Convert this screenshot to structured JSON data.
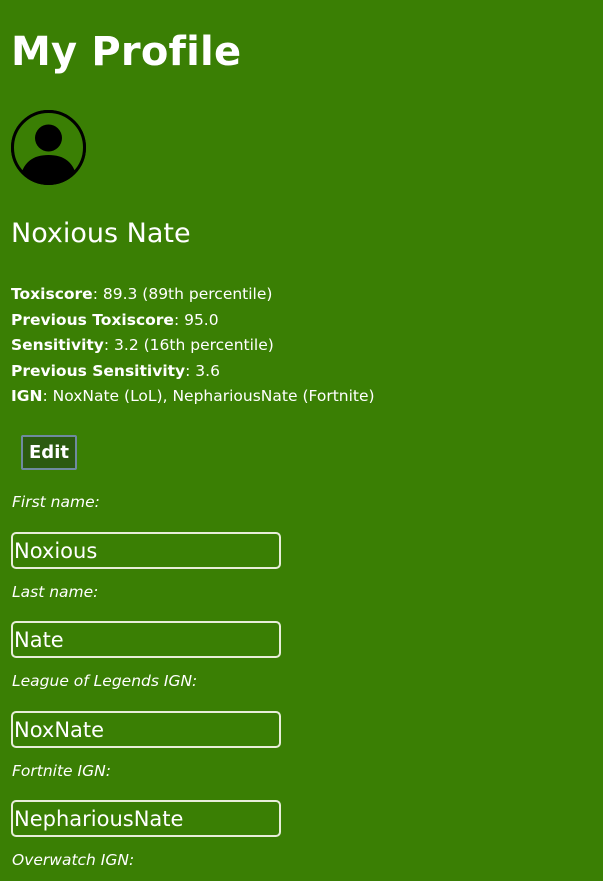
{
  "page": {
    "title": "My Profile"
  },
  "profile": {
    "display_name": "Noxious Nate",
    "avatar_icon": "user-avatar-icon",
    "stats": [
      {
        "key": "Toxiscore",
        "value": ": 89.3 (89th percentile)"
      },
      {
        "key": "Previous Toxiscore",
        "value": ": 95.0"
      },
      {
        "key": "Sensitivity",
        "value": ": 3.2 (16th percentile)"
      },
      {
        "key": "Previous Sensitivity",
        "value": ": 3.6"
      },
      {
        "key": "IGN",
        "value": ": NoxNate (LoL), NephariousNate (Fortnite)"
      }
    ]
  },
  "actions": {
    "edit_label": "Edit"
  },
  "form": {
    "fields": [
      {
        "label": "First name:",
        "value": "Noxious"
      },
      {
        "label": "Last name:",
        "value": "Nate"
      },
      {
        "label": "League of Legends IGN:",
        "value": "NoxNate"
      },
      {
        "label": "Fortnite IGN:",
        "value": "NephariousNate"
      },
      {
        "label": "Overwatch IGN:",
        "value": ""
      }
    ]
  },
  "colors": {
    "background": "#3a7f04",
    "text": "#ffffff",
    "button_bg": "#2c5a10"
  }
}
